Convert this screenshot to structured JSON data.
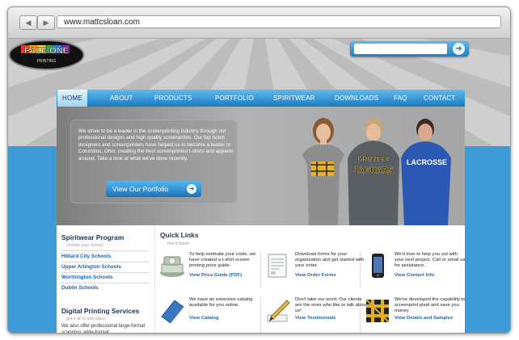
{
  "browser": {
    "back_icon": "back-arrow-icon",
    "forward_icon": "forward-arrow-icon",
    "url": "www.mattcsloan.com"
  },
  "brand": {
    "logo_text": "FAZE ONE",
    "logo_subtext": "PRINTING",
    "accent_blue": "#3d9ad4",
    "nav_blue": "#1c79be",
    "link_blue": "#1f62b0",
    "heading_navy": "#1f3555"
  },
  "search": {
    "placeholder": "",
    "go_icon": "arrow-right-icon"
  },
  "nav": {
    "items": [
      {
        "label": "HOME",
        "active": true
      },
      {
        "label": "ABOUT"
      },
      {
        "label": "PRODUCTS"
      },
      {
        "label": "PORTFOLIO"
      },
      {
        "label": "SPIRITWEAR"
      },
      {
        "label": "DOWNLOADS"
      },
      {
        "label": "FAQ"
      },
      {
        "label": "CONTACT"
      }
    ]
  },
  "hero": {
    "text": "We strive to be a leader in the screenprinting industry through our professional designs and high quality screenprints. Our top notch designers and screenprinters have helped us to become a leader in Columbus, Ohio, creating the best screenprinted t-shirts and apparel around. Take a look at what we've done recently.",
    "button_label": "View Our Portfolio",
    "shirt_text_1": "GRIZZLEY",
    "shirt_text_2": "JAGUARS",
    "shirt_text_3": "LACROSSE"
  },
  "sidebar": {
    "spiritwear_title": "Spiritwear Program",
    "spiritwear_sub": "choose your school",
    "schools": [
      "Hilliard City Schools",
      "Upper Arlington Schools",
      "Worthington Schools",
      "Dublin Schools"
    ],
    "digital_title": "Digital Printing Services",
    "digital_sub": "get it all in one place",
    "digital_text": "We also offer professional large-format scanning, wide-format"
  },
  "quick_links": {
    "title": "Quick Links",
    "subtitle": "find it faster",
    "cards": [
      {
        "icon": "cash-stack-icon",
        "text": "To help estimate your costs, we have created a t-shirt screen printing price guide.",
        "link": "View Price Guide (PDF)"
      },
      {
        "icon": "document-form-icon",
        "text": "Download forms for your organization and get started with your order.",
        "link": "View Order Forms"
      },
      {
        "icon": "phone-icon",
        "text": "We'd love to help you out with your next project. Call or email us for assistance.",
        "link": "View Contact Info"
      },
      {
        "icon": "catalog-book-icon",
        "text": "We have an extensive catalog available for you online.",
        "link": "View Catalog"
      },
      {
        "icon": "quill-pen-icon",
        "text": "Don't take our word. Our clients are the ones who like to talk about us!",
        "link": "View Testimonials"
      },
      {
        "icon": "plaid-swatch-icon",
        "text": "We've developed the capability to screenprint plaid and save you money",
        "link": "View Details and Samples"
      }
    ]
  }
}
